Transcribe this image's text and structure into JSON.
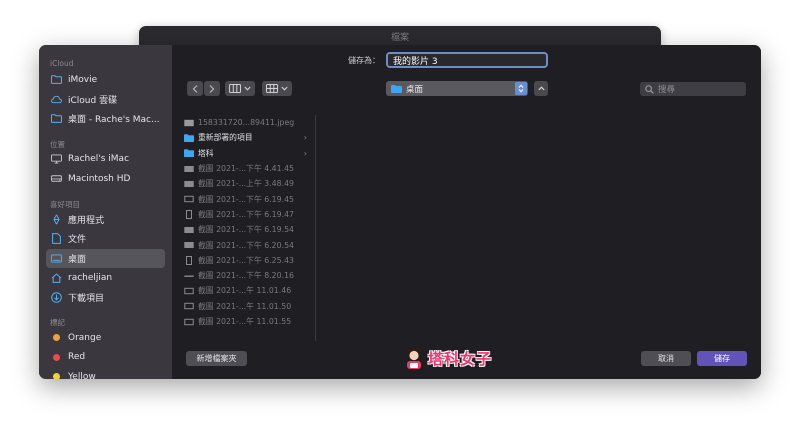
{
  "background_window": {
    "title": "檔案"
  },
  "sidebar": {
    "sections": [
      {
        "heading": "iCloud",
        "items": [
          {
            "label": "iMovie",
            "icon": "folder-icon"
          },
          {
            "label": "iCloud 雲碟",
            "icon": "cloud-icon"
          },
          {
            "label": "桌面 - Rache's Mac...",
            "icon": "folder-icon"
          }
        ]
      },
      {
        "heading": "位置",
        "items": [
          {
            "label": "Rachel's iMac",
            "icon": "monitor-icon"
          },
          {
            "label": "Macintosh HD",
            "icon": "disk-icon"
          }
        ]
      },
      {
        "heading": "喜好項目",
        "items": [
          {
            "label": "應用程式",
            "icon": "apps-icon"
          },
          {
            "label": "文件",
            "icon": "document-icon"
          },
          {
            "label": "桌面",
            "icon": "desktop-icon",
            "active": true
          },
          {
            "label": "racheljian",
            "icon": "home-icon"
          },
          {
            "label": "下載項目",
            "icon": "download-icon"
          }
        ]
      },
      {
        "heading": "標記",
        "tags": [
          {
            "label": "Orange",
            "color": "#f0a33b"
          },
          {
            "label": "Red",
            "color": "#ec4c45"
          },
          {
            "label": "Yellow",
            "color": "#f3cf3a"
          }
        ]
      }
    ]
  },
  "saveas": {
    "label": "儲存為：",
    "value": "我的影片 3"
  },
  "location": {
    "label": "桌面"
  },
  "search": {
    "placeholder": "搜尋"
  },
  "files": [
    {
      "name": "158331720...89411.jpeg",
      "type": "image"
    },
    {
      "name": "重新部署的項目",
      "type": "folder"
    },
    {
      "name": "塔科",
      "type": "folder"
    },
    {
      "name": "截圖 2021-...下午 4.41.45",
      "type": "shot"
    },
    {
      "name": "截圖 2021-...上午 3.48.49",
      "type": "shot"
    },
    {
      "name": "截圖 2021-...下午 6.19.45",
      "type": "shot-outline"
    },
    {
      "name": "截圖 2021-...下午 6.19.47",
      "type": "shot-tall"
    },
    {
      "name": "截圖 2021-...下午 6.19.54",
      "type": "shot"
    },
    {
      "name": "截圖 2021-...下午 6.20.54",
      "type": "shot"
    },
    {
      "name": "截圖 2021-...下午 6.25.43",
      "type": "shot-tall"
    },
    {
      "name": "截圖 2021-...下午 8.20.16",
      "type": "shot-flat"
    },
    {
      "name": "截圖 2021-...午 11.01.46",
      "type": "shot-outline"
    },
    {
      "name": "截圖 2021-...午 11.01.50",
      "type": "shot-outline"
    },
    {
      "name": "截圖 2021-...午 11.01.55",
      "type": "shot-outline"
    }
  ],
  "buttons": {
    "new_folder": "新增檔案夾",
    "cancel": "取消",
    "save": "儲存"
  },
  "watermark": {
    "text": "塔科女子"
  },
  "colors": {
    "accent": "#6a8ed3",
    "save": "#6153b8",
    "brand": "#f2336b"
  }
}
